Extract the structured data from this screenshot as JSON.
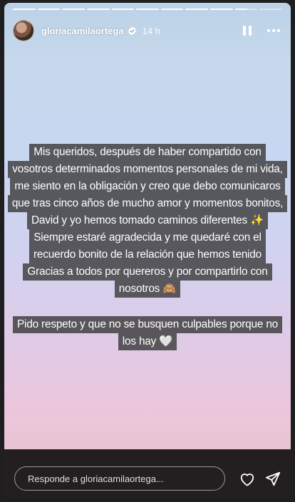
{
  "story": {
    "segments_total": 11,
    "segments_done": 9,
    "active_segment_progress": 0.55
  },
  "header": {
    "username": "gloriacamilaortega",
    "time": "14 h",
    "icons": [
      "verified-badge-icon",
      "pause-icon",
      "more-icon"
    ]
  },
  "message": {
    "paragraph1": [
      "Mis queridos, después de haber compartido con",
      "vosotros determinados momentos personales de mi vida,",
      "me siento en la obligación y creo que debo comunicaros",
      "que tras cinco años de mucho amor y momentos bonitos,",
      "David y yo hemos tomado caminos diferentes ✨",
      "Siempre estaré agradecida y me quedaré con el",
      "recuerdo bonito de la relación que hemos tenido",
      "Gracias a todos por quereros y por compartirlo con",
      "nosotros 🙈"
    ],
    "paragraph2": [
      "Pido respeto y que no se busquen culpables porque no",
      "los hay 🤍"
    ]
  },
  "footer": {
    "reply_placeholder": "Responde a gloriacamilaortega...",
    "icons": [
      "heart-icon",
      "send-icon"
    ]
  },
  "colors": {
    "text_bg": "#3c3c3c",
    "text": "#ffffff",
    "gradient_top": "#bcd2e6",
    "gradient_bottom": "#ecc6da"
  }
}
